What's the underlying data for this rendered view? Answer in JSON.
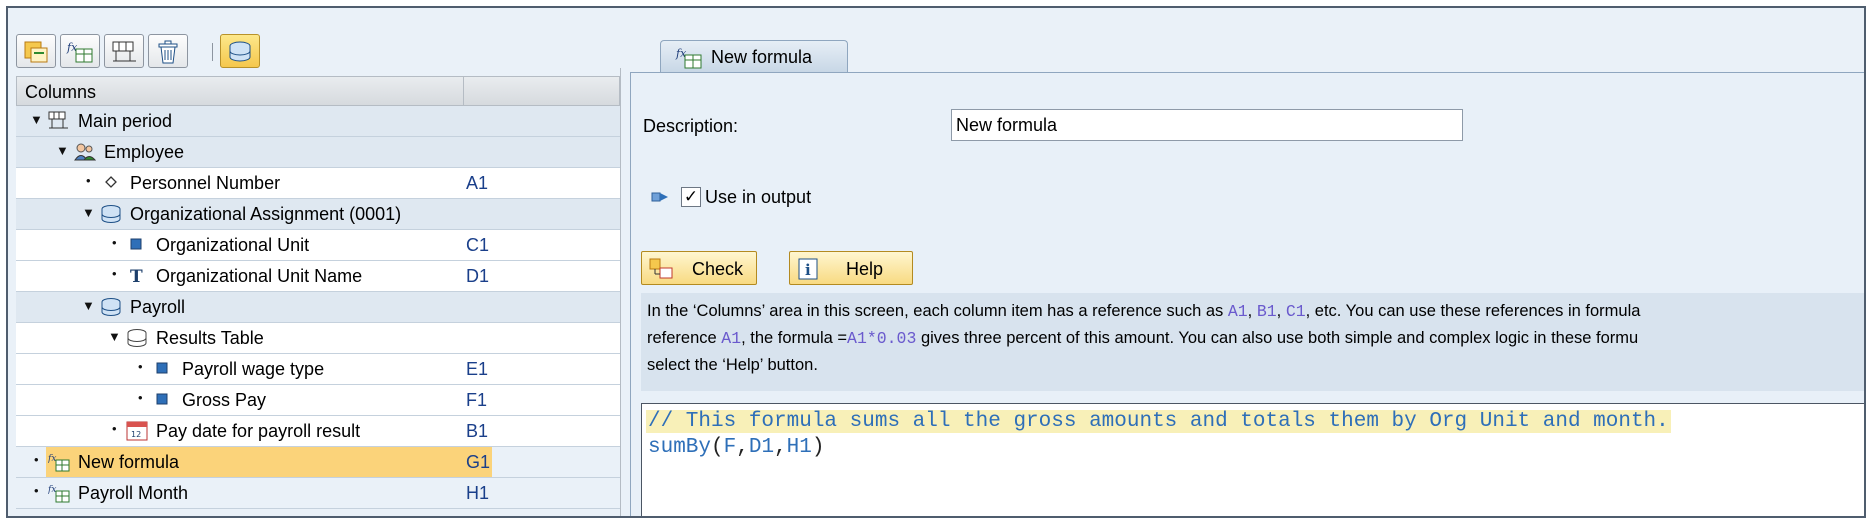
{
  "toolbar": {
    "buttons": [
      "add-column-icon",
      "add-formula-icon",
      "group-icon",
      "delete-icon",
      "database-icon"
    ]
  },
  "columns_panel": {
    "header": "Columns",
    "tree": [
      {
        "label": "Main period",
        "ref": "",
        "icon": "period-grid-icon"
      },
      {
        "label": "Employee",
        "ref": "",
        "icon": "employee-icon"
      },
      {
        "label": "Personnel Number",
        "ref": "A1",
        "icon": "key-field-icon"
      },
      {
        "label": "Organizational Assignment (0001)",
        "ref": "",
        "icon": "infotype-icon"
      },
      {
        "label": "Organizational Unit",
        "ref": "C1",
        "icon": "field-icon"
      },
      {
        "label": "Organizational Unit Name",
        "ref": "D1",
        "icon": "text-field-icon"
      },
      {
        "label": "Payroll",
        "ref": "",
        "icon": "infotype-icon"
      },
      {
        "label": "Results Table",
        "ref": "",
        "icon": "table-icon"
      },
      {
        "label": "Payroll wage type",
        "ref": "E1",
        "icon": "field-icon"
      },
      {
        "label": "Gross Pay",
        "ref": "F1",
        "icon": "field-icon"
      },
      {
        "label": "Pay date for payroll result",
        "ref": "B1",
        "icon": "calendar-icon"
      },
      {
        "label": "New formula",
        "ref": "G1",
        "icon": "formula-icon"
      },
      {
        "label": "Payroll Month",
        "ref": "H1",
        "icon": "formula-icon"
      }
    ]
  },
  "tab": {
    "label": "New formula"
  },
  "form": {
    "description_label": "Description:",
    "description_value": "New formula",
    "use_in_output_label": "Use in output",
    "use_in_output_checked": "✓"
  },
  "buttons": {
    "check": "Check",
    "help": "Help"
  },
  "info": {
    "line1_a": "In the ‘Columns’ area in this screen, each column item has a reference such as ",
    "c_a1": "A1",
    "sep1": ", ",
    "c_b1": "B1",
    "sep2": ", ",
    "c_c1": "C1",
    "line1_b": ", etc. You can use these references in formula",
    "line2_a": "reference ",
    "c_a1b": "A1",
    "line2_b": ", the formula =",
    "c_expr": "A1*0.03",
    "line2_c": " gives three percent of this amount. You can also use both simple and complex logic in these formu",
    "line3": "select the ‘Help’ button."
  },
  "editor": {
    "comment": "// This formula sums all the gross amounts and totals them by Org Unit and month.",
    "fn": "sumBy",
    "open": "(",
    "a1": "F",
    "c1": ",",
    "a2": "D1",
    "c2": ",",
    "a3": "H1",
    "close": ")"
  }
}
